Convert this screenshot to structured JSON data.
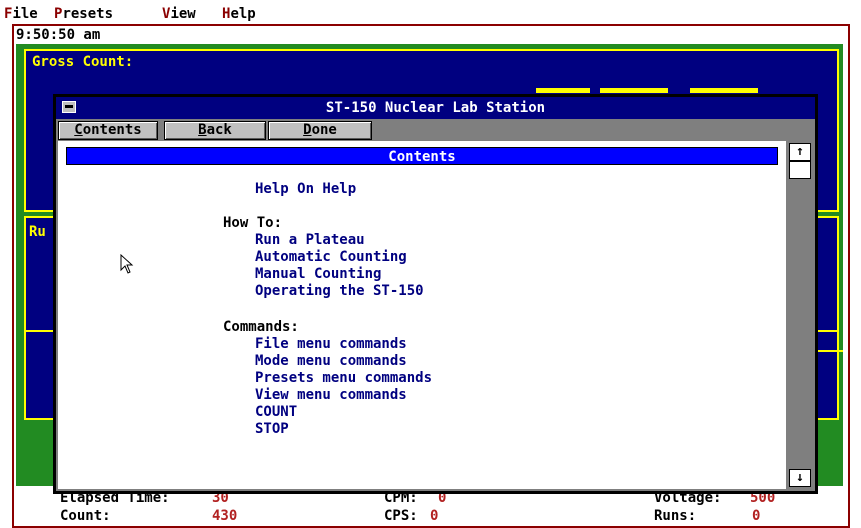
{
  "menubar": {
    "items": [
      {
        "hot": "F",
        "rest": "ile"
      },
      {
        "hot": "P",
        "rest": "resets"
      },
      {
        "hot": "V",
        "rest": "iew"
      },
      {
        "hot": "H",
        "rest": "elp"
      }
    ]
  },
  "app": {
    "clock": "9:50:50 am",
    "gross_count_label": "Gross Count:",
    "runs_panel_label_fragment": "Ru"
  },
  "status": {
    "elapsed_label": "Elapsed Time:",
    "elapsed_value": "30",
    "cpm_label": "CPM:",
    "cpm_value": "0",
    "voltage_label": "Voltage:",
    "voltage_value": "500",
    "count_label": "Count:",
    "count_value": "430",
    "cps_label": "CPS:",
    "cps_value": "0",
    "runs_label": "Runs:",
    "runs_value": "0"
  },
  "dialog": {
    "title": "ST-150 Nuclear Lab Station",
    "buttons": {
      "contents": {
        "hot": "C",
        "rest": "ontents"
      },
      "back": {
        "hot": "B",
        "rest": "ack"
      },
      "done": {
        "hot": "D",
        "rest": "one"
      }
    },
    "heading": "Contents",
    "help_on_help": "Help On Help",
    "howto_heading": "How To:",
    "howto_links": [
      "Run a Plateau",
      "Automatic Counting",
      "Manual Counting",
      "Operating the ST-150"
    ],
    "commands_heading": "Commands:",
    "command_links": [
      "File menu commands",
      "Mode menu commands",
      "Presets menu commands",
      "View menu commands",
      "COUNT",
      "STOP"
    ],
    "scroll_up": "↑",
    "scroll_down": "↓"
  },
  "colors": {
    "accent_red": "#8b0000",
    "panel_navy": "#000080",
    "panel_border": "#ffff00",
    "background_green": "#228b22",
    "heading_blue": "#0000ff"
  },
  "icons": {
    "system_menu": "system-menu-icon",
    "cursor": "mouse-pointer-icon",
    "scroll_up": "scroll-up-arrow-icon",
    "scroll_down": "scroll-down-arrow-icon"
  }
}
